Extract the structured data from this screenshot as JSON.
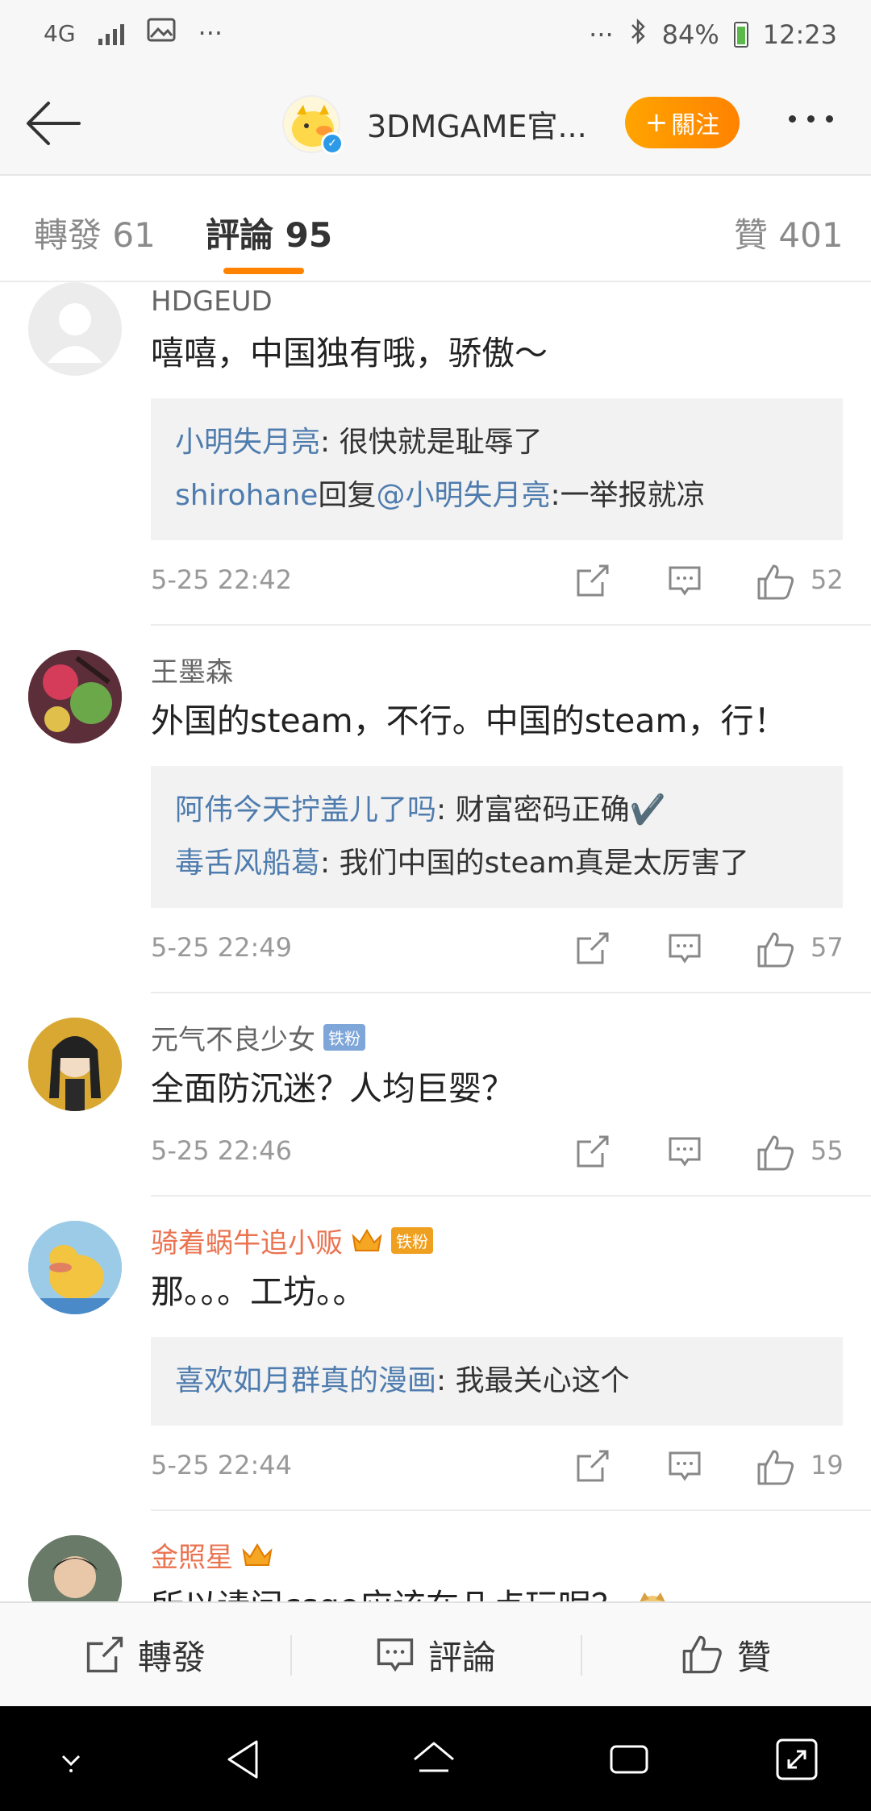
{
  "status_bar": {
    "network": "4G",
    "dots": "···",
    "battery_percent": "84%",
    "time": "12:23"
  },
  "header": {
    "profile_name": "3DMGAME官...",
    "follow_label": "關注"
  },
  "tabs": [
    {
      "label": "轉發",
      "count": "61"
    },
    {
      "label": "評論",
      "count": "95"
    },
    {
      "label": "贊",
      "count": "401"
    }
  ],
  "comments": [
    {
      "username": "HDGEUD",
      "text": "嘻嘻，中国独有哦，骄傲～",
      "replies": [
        {
          "name": "小明失月亮",
          "text": ": 很快就是耻辱了"
        },
        {
          "name": "shirohane",
          "text": "回复",
          "mention": "@小明失月亮",
          "tail": ":一举报就凉"
        }
      ],
      "time": "5-25 22:42",
      "likes": "52"
    },
    {
      "username": "王墨森",
      "text": "外国的steam，不行。中国的steam，行！",
      "replies": [
        {
          "name": "阿伟今天拧盖儿了吗",
          "text": ": 财富密码正确✔️"
        },
        {
          "name": "毒舌风船葛",
          "text": ": 我们中国的steam真是太厉害了"
        }
      ],
      "time": "5-25 22:49",
      "likes": "57"
    },
    {
      "username": "元气不良少女",
      "badge": "铁粉",
      "text": "全面防沉迷？人均巨婴？",
      "time": "5-25 22:46",
      "likes": "55"
    },
    {
      "username": "骑着蜗牛追小贩",
      "badge": "铁粉",
      "text": "那。。。工坊。。",
      "replies": [
        {
          "name": "喜欢如月群真的漫画",
          "text": ": 我最关心这个"
        }
      ],
      "time": "5-25 22:44",
      "likes": "19"
    },
    {
      "username": "金照星",
      "text": "所以请问csgo应该在几点玩呢？"
    }
  ],
  "action_bar": {
    "repost": "轉發",
    "comment": "評論",
    "like": "贊"
  },
  "colors": {
    "accent_orange": "#ff8200",
    "reply_blue": "#4e7cae",
    "vip_name": "#eb7350"
  }
}
